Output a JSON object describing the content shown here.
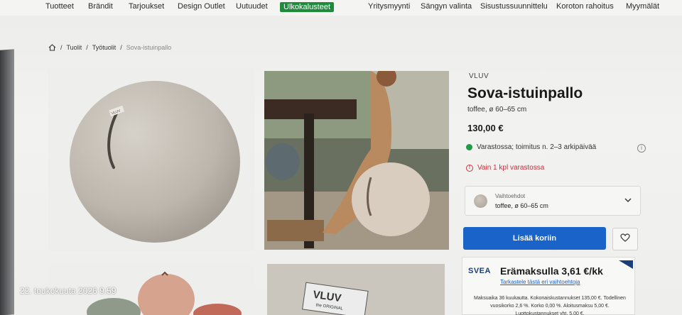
{
  "topnav": {
    "items": [
      {
        "label": "Tuotteet"
      },
      {
        "label": "Brändit"
      },
      {
        "label": "Tarjoukset"
      },
      {
        "label": "Design Outlet"
      },
      {
        "label": "Uutuudet"
      },
      {
        "label": "Ulkokalusteet"
      },
      {
        "label": "Yritysmyynti"
      },
      {
        "label": "Sängyn valinta"
      },
      {
        "label": "Sisustussuunnittelu"
      },
      {
        "label": "Koroton rahoitus"
      },
      {
        "label": "Myymälät"
      }
    ]
  },
  "breadcrumb": {
    "items": [
      "Tuolit",
      "Työtuolit",
      "Sova-istuinpallo"
    ]
  },
  "gallery": {
    "ball_tag_text": "VLUV",
    "box_text": "VLUV",
    "box_subtext": "the ORIGINAL"
  },
  "product": {
    "brand": "VLUV",
    "title": "Sova-istuinpallo",
    "variant_summary": "toffee, ø 60–65 cm",
    "price": "130,00 €",
    "stock_status": "Varastossa; toimitus n. 2–3 arkipäivää",
    "low_stock": "Vain 1 kpl varastossa",
    "variant_select": {
      "label": "Vaihtoehdot",
      "value": "toffee, ø 60–65 cm"
    },
    "add_to_cart": "Lisää koriin"
  },
  "financing": {
    "logo": "SVEA",
    "title": "Erämaksulla 3,61 €/kk",
    "link": "Tarkastele tästä eri vaihtoehtoja",
    "terms": "Maksuaika 36 kuukautta. Kokonaiskustannukset 135,00 €. Todellinen vuosikorko 2,6 %. Korko 0,00 %. Aloitusmaksu 5,00 €. Luottokustannukset yht. 5,00 €."
  },
  "photo_timestamp": "22. toukokuuta 2026 9.59",
  "colors": {
    "accent_green": "#1f8a3c",
    "button_blue": "#1a63c9",
    "alert_red": "#c8323c",
    "svea_navy": "#1b3d7a"
  }
}
